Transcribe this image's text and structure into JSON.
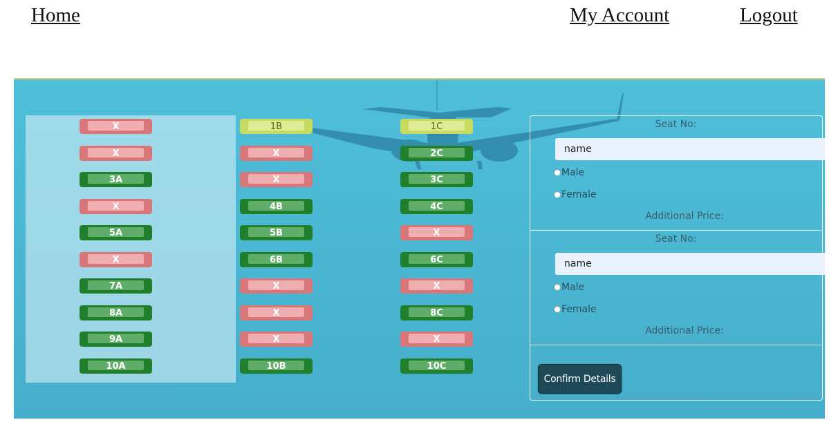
{
  "nav": {
    "home": "Home",
    "account": "My Account",
    "logout": "Logout"
  },
  "seats": {
    "col_a": [
      {
        "label": "X",
        "status": "taken"
      },
      {
        "label": "X",
        "status": "taken"
      },
      {
        "label": "3A",
        "status": "available"
      },
      {
        "label": "X",
        "status": "taken"
      },
      {
        "label": "5A",
        "status": "available"
      },
      {
        "label": "X",
        "status": "taken"
      },
      {
        "label": "7A",
        "status": "available"
      },
      {
        "label": "8A",
        "status": "available"
      },
      {
        "label": "9A",
        "status": "available"
      },
      {
        "label": "10A",
        "status": "available"
      }
    ],
    "col_b": [
      {
        "label": "1B",
        "status": "selected"
      },
      {
        "label": "X",
        "status": "taken"
      },
      {
        "label": "X",
        "status": "taken"
      },
      {
        "label": "4B",
        "status": "available"
      },
      {
        "label": "5B",
        "status": "available"
      },
      {
        "label": "6B",
        "status": "available"
      },
      {
        "label": "X",
        "status": "taken"
      },
      {
        "label": "X",
        "status": "taken"
      },
      {
        "label": "X",
        "status": "taken"
      },
      {
        "label": "10B",
        "status": "available"
      }
    ],
    "col_c": [
      {
        "label": "1C",
        "status": "selected"
      },
      {
        "label": "2C",
        "status": "available"
      },
      {
        "label": "3C",
        "status": "available"
      },
      {
        "label": "4C",
        "status": "available"
      },
      {
        "label": "X",
        "status": "taken"
      },
      {
        "label": "6C",
        "status": "available"
      },
      {
        "label": "X",
        "status": "taken"
      },
      {
        "label": "8C",
        "status": "available"
      },
      {
        "label": "X",
        "status": "taken"
      },
      {
        "label": "10C",
        "status": "available"
      }
    ]
  },
  "passengers": [
    {
      "seat_label": "Seat No:",
      "name_value": "name",
      "male": "Male",
      "female": "Female",
      "price_label": "Additional Price:"
    },
    {
      "seat_label": "Seat No:",
      "name_value": "name",
      "male": "Male",
      "female": "Female",
      "price_label": "Additional Price:"
    }
  ],
  "confirm_label": "Confirm Details",
  "colors": {
    "available": "#1f7f2a",
    "taken": "#d9767a",
    "selected": "#c7dc5e",
    "background": "#4fbfd9",
    "button": "#1d4a56"
  }
}
